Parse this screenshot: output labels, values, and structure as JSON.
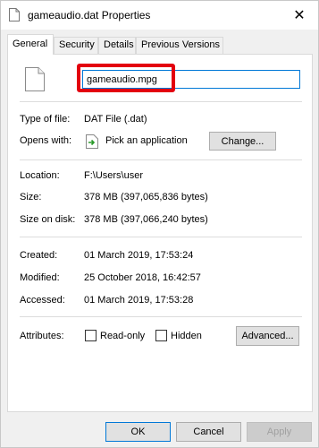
{
  "window": {
    "title": "gameaudio.dat Properties",
    "close_glyph": "✕"
  },
  "tabs": [
    {
      "label": "General",
      "active": true
    },
    {
      "label": "Security",
      "active": false
    },
    {
      "label": "Details",
      "active": false
    },
    {
      "label": "Previous Versions",
      "active": false
    }
  ],
  "general": {
    "filename_value": "gameaudio.mpg",
    "type_label": "Type of file:",
    "type_value": "DAT File (.dat)",
    "opens_label": "Opens with:",
    "opens_value": "Pick an application",
    "change_button": "Change...",
    "location_label": "Location:",
    "location_value": "F:\\Users\\user",
    "size_label": "Size:",
    "size_value": "378 MB (397,065,836 bytes)",
    "size_on_disk_label": "Size on disk:",
    "size_on_disk_value": "378 MB (397,066,240 bytes)",
    "created_label": "Created:",
    "created_value": "01 March 2019, 17:53:24",
    "modified_label": "Modified:",
    "modified_value": "25 October 2018, 16:42:57",
    "accessed_label": "Accessed:",
    "accessed_value": "01 March 2019, 17:53:28",
    "attributes_label": "Attributes:",
    "readonly_label": "Read-only",
    "hidden_label": "Hidden",
    "advanced_button": "Advanced..."
  },
  "footer": {
    "ok": "OK",
    "cancel": "Cancel",
    "apply": "Apply"
  },
  "colors": {
    "highlight": "#e3000f",
    "focus": "#0078d7"
  }
}
